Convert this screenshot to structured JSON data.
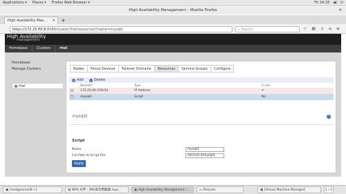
{
  "system_bar": {
    "applications": "Applications ▾",
    "places": "Places ▾",
    "firefox": "Firefox Web Browser ▾",
    "clock": "Fri 14:18"
  },
  "window": {
    "title": "High Availability Management – Mozilla Firefox"
  },
  "browser": {
    "tab_title": "High Availability Man...",
    "url_host": "https://172.25.60.8",
    "url_rest": ":8084/cluster/rhel/resources/?name=mysqld",
    "search_placeholder": "Search"
  },
  "app": {
    "brand": "High Availability",
    "brand_sub": "management",
    "breadcrumbs": [
      "Homebase",
      "Clusters",
      "rhel"
    ],
    "left_nav": [
      "Homebase",
      "Manage Clusters"
    ],
    "cluster_name": "rhel",
    "tabs": [
      "Nodes",
      "Fence Devices",
      "Failover Domains",
      "Resources",
      "Service Groups",
      "Configure"
    ],
    "active_tab": "Resources",
    "toolbar": {
      "add": "Add",
      "delete": "Delete"
    },
    "table": {
      "headers": [
        "Name/IP",
        "Type",
        "In Use"
      ],
      "rows": [
        {
          "name": "172.25.60.100/24",
          "type": "IP Address",
          "in_use": "✔"
        },
        {
          "name": "mysqld",
          "type": "Script",
          "in_use": "No"
        }
      ]
    },
    "detail": {
      "title": "mysqld",
      "section": "Script",
      "fields": [
        {
          "label": "Name",
          "value": "mysqld"
        },
        {
          "label": "Full Path to Script File",
          "value": "/etc/init.d/mysqld"
        }
      ],
      "apply": "Apply"
    }
  },
  "taskbar": {
    "items": [
      "[root@server8:~]",
      "WPS 文字 - [MA高可用集群-mys...",
      "High Availability Management –...",
      "Pictures",
      "[Virtual Machine Manager]"
    ],
    "pager": "1 / 4"
  },
  "colors": {
    "accent_blue": "#2f66b6",
    "selected_row": "#c7dcef",
    "header_dark": "#1e1e1e"
  }
}
